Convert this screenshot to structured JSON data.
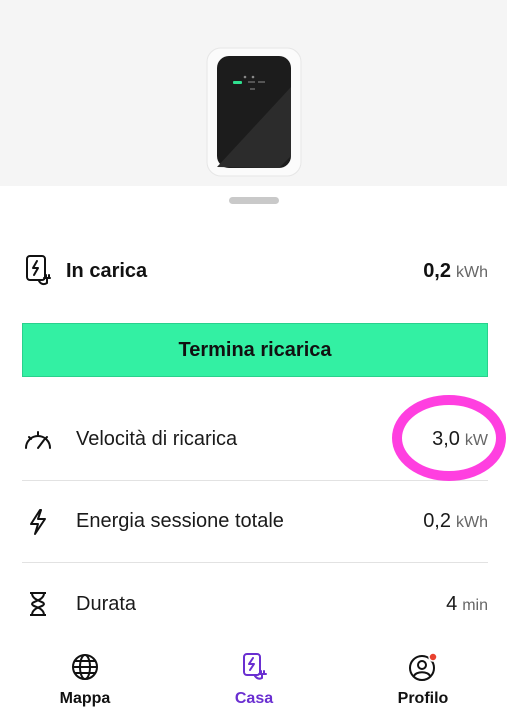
{
  "session": {
    "status_label": "In carica",
    "energy_value": "0,2",
    "energy_unit": "kWh",
    "stop_button_label": "Termina ricarica"
  },
  "stats": [
    {
      "label": "Velocità di ricarica",
      "value": "3,0",
      "unit": "kW",
      "icon": "speedometer-icon"
    },
    {
      "label": "Energia sessione totale",
      "value": "0,2",
      "unit": "kWh",
      "icon": "lightning-icon"
    },
    {
      "label": "Durata",
      "value": "4",
      "unit": "min",
      "icon": "hourglass-icon"
    }
  ],
  "tabs": [
    {
      "label": "Mappa",
      "icon": "globe-icon",
      "active": false
    },
    {
      "label": "Casa",
      "icon": "home-charger-icon",
      "active": true
    },
    {
      "label": "Profilo",
      "icon": "profile-icon",
      "active": false,
      "has_notification": true
    }
  ],
  "colors": {
    "accent_green": "#33f0a3",
    "active_tab": "#6a2fd1",
    "highlight": "#ff3fe0",
    "notification_dot": "#e8412e"
  }
}
